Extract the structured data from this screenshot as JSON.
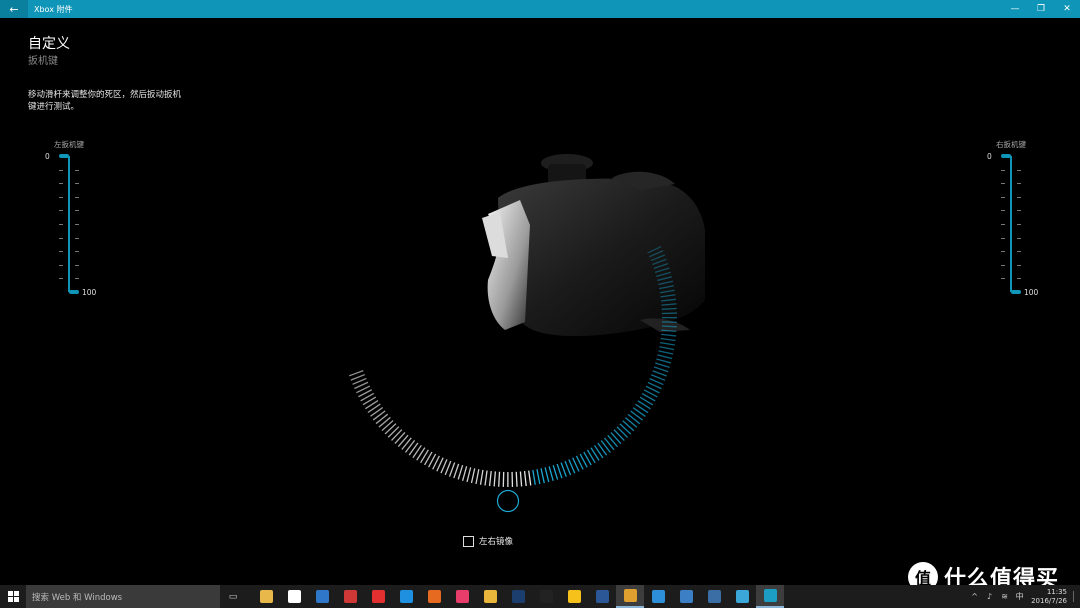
{
  "window": {
    "title": "Xbox 附件",
    "back_icon": "back-arrow-icon",
    "titlebar_color": "#0e95b8"
  },
  "header": {
    "title": "自定义",
    "subtitle": "扳机键"
  },
  "instruction": "移动滑杆来调整你的死区，然后扳动扳机键进行测试。",
  "left_slider": {
    "label": "左扳机键",
    "min_label": "0",
    "max_label": "100",
    "value_min": 0,
    "value_max": 100
  },
  "right_slider": {
    "label": "右扳机键",
    "min_label": "0",
    "max_label": "100",
    "value_min": 0,
    "value_max": 100
  },
  "trigger_wheel": {
    "accent": "#1ba8d4",
    "filled_fraction": 0.5
  },
  "mirror_option": {
    "label": "左右镜像",
    "checked": false
  },
  "taskbar": {
    "search_placeholder": "搜索 Web 和 Windows",
    "apps": [
      {
        "name": "file-explorer-icon",
        "color": "#e8b84a"
      },
      {
        "name": "store-icon",
        "color": "#ffffff"
      },
      {
        "name": "outlook-icon",
        "color": "#2f77c9"
      },
      {
        "name": "game-icon",
        "color": "#d03838"
      },
      {
        "name": "netease-music-icon",
        "color": "#e23030"
      },
      {
        "name": "edge-icon",
        "color": "#1f8fe0"
      },
      {
        "name": "firefox-icon",
        "color": "#e66a1f"
      },
      {
        "name": "itunes-icon",
        "color": "#e83d6b"
      },
      {
        "name": "chrome-icon",
        "color": "#e9b53a"
      },
      {
        "name": "photoshop-icon",
        "color": "#1b3e6e"
      },
      {
        "name": "qq-icon",
        "color": "#222222"
      },
      {
        "name": "feather-icon",
        "color": "#f5c11a"
      },
      {
        "name": "word-icon",
        "color": "#2b5797"
      },
      {
        "name": "qq-active-icon",
        "color": "#e0a030"
      },
      {
        "name": "browser-icon",
        "color": "#2d8fd8"
      },
      {
        "name": "vs-icon",
        "color": "#3c7fc4"
      },
      {
        "name": "tool-icon",
        "color": "#3a6ea5"
      },
      {
        "name": "cloud-icon",
        "color": "#3aa7d8"
      },
      {
        "name": "xbox-accessories-icon",
        "color": "#1c9ec4"
      }
    ],
    "clock_time": "11:35",
    "clock_date": "2016/7/26"
  },
  "watermark": {
    "text": "什么值得买",
    "logo_glyph": "值"
  }
}
